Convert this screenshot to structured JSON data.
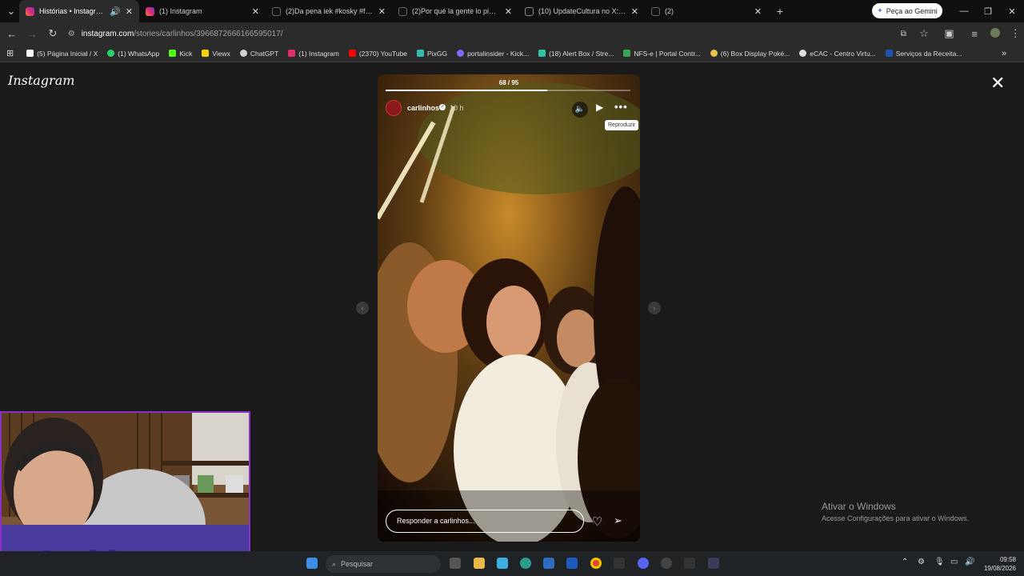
{
  "tabs": [
    {
      "label": "Histórias • Instagram",
      "active": true,
      "icon": "instagram-icon"
    },
    {
      "label": "(1) Instagram",
      "active": false,
      "icon": "instagram-icon"
    },
    {
      "label": "(2)Da pena iek #kosky #fontin",
      "active": false,
      "icon": "tiktok-icon"
    },
    {
      "label": "(2)Por qué la gente lo pide, Par",
      "active": false,
      "icon": "tiktok-icon"
    },
    {
      "label": "(10) UpdateCultura no X: \"May",
      "active": false,
      "icon": "x-icon"
    },
    {
      "label": "(2)",
      "active": false,
      "icon": "tiktok-icon"
    }
  ],
  "gemini_label": "Peça ao Gemini",
  "address": {
    "site": "instagram.com",
    "path": "/stories/carlinhos/3966872666166595017/"
  },
  "bookmarks": [
    {
      "label": "(5) Página Inicial / X",
      "color": "#ffffff"
    },
    {
      "label": "(1) WhatsApp",
      "color": "#25d366"
    },
    {
      "label": "Kick",
      "color": "#53fc18"
    },
    {
      "label": "Viewx",
      "color": "#f5d20b"
    },
    {
      "label": "ChatGPT",
      "color": "#d0d0d0"
    },
    {
      "label": "(1) Instagram",
      "color": "#e1306c"
    },
    {
      "label": "(2370) YouTube",
      "color": "#ff0000"
    },
    {
      "label": "PixGG",
      "color": "#32bcad"
    },
    {
      "label": "portalinsider - Kick...",
      "color": "#7b6cff"
    },
    {
      "label": "(18) Alert Box / Stre...",
      "color": "#31c3a2"
    },
    {
      "label": "NFS-e | Portal Contr...",
      "color": "#3aa655"
    },
    {
      "label": "(6) Box Display Poké...",
      "color": "#e8c34a"
    },
    {
      "label": "eCAC - Centro Virtu...",
      "color": "#dddddd"
    },
    {
      "label": "Serviços da Receita...",
      "color": "#2050b0"
    }
  ],
  "instagram": {
    "logo": "Instagram",
    "story": {
      "counter": "68 / 95",
      "progress": 0.66,
      "username": "carlinhos",
      "time": "10 h",
      "tooltip": "Reproduzir",
      "reply_placeholder": "Responder a carlinhos..."
    }
  },
  "windows_activation": {
    "title": "Ativar o Windows",
    "subtitle": "Acesse Configurações para ativar o Windows."
  },
  "overlay": {
    "brand": "Insider"
  },
  "taskbar": {
    "search_placeholder": "Pesquisar",
    "time": "09:58",
    "date": "19/08/2026"
  }
}
